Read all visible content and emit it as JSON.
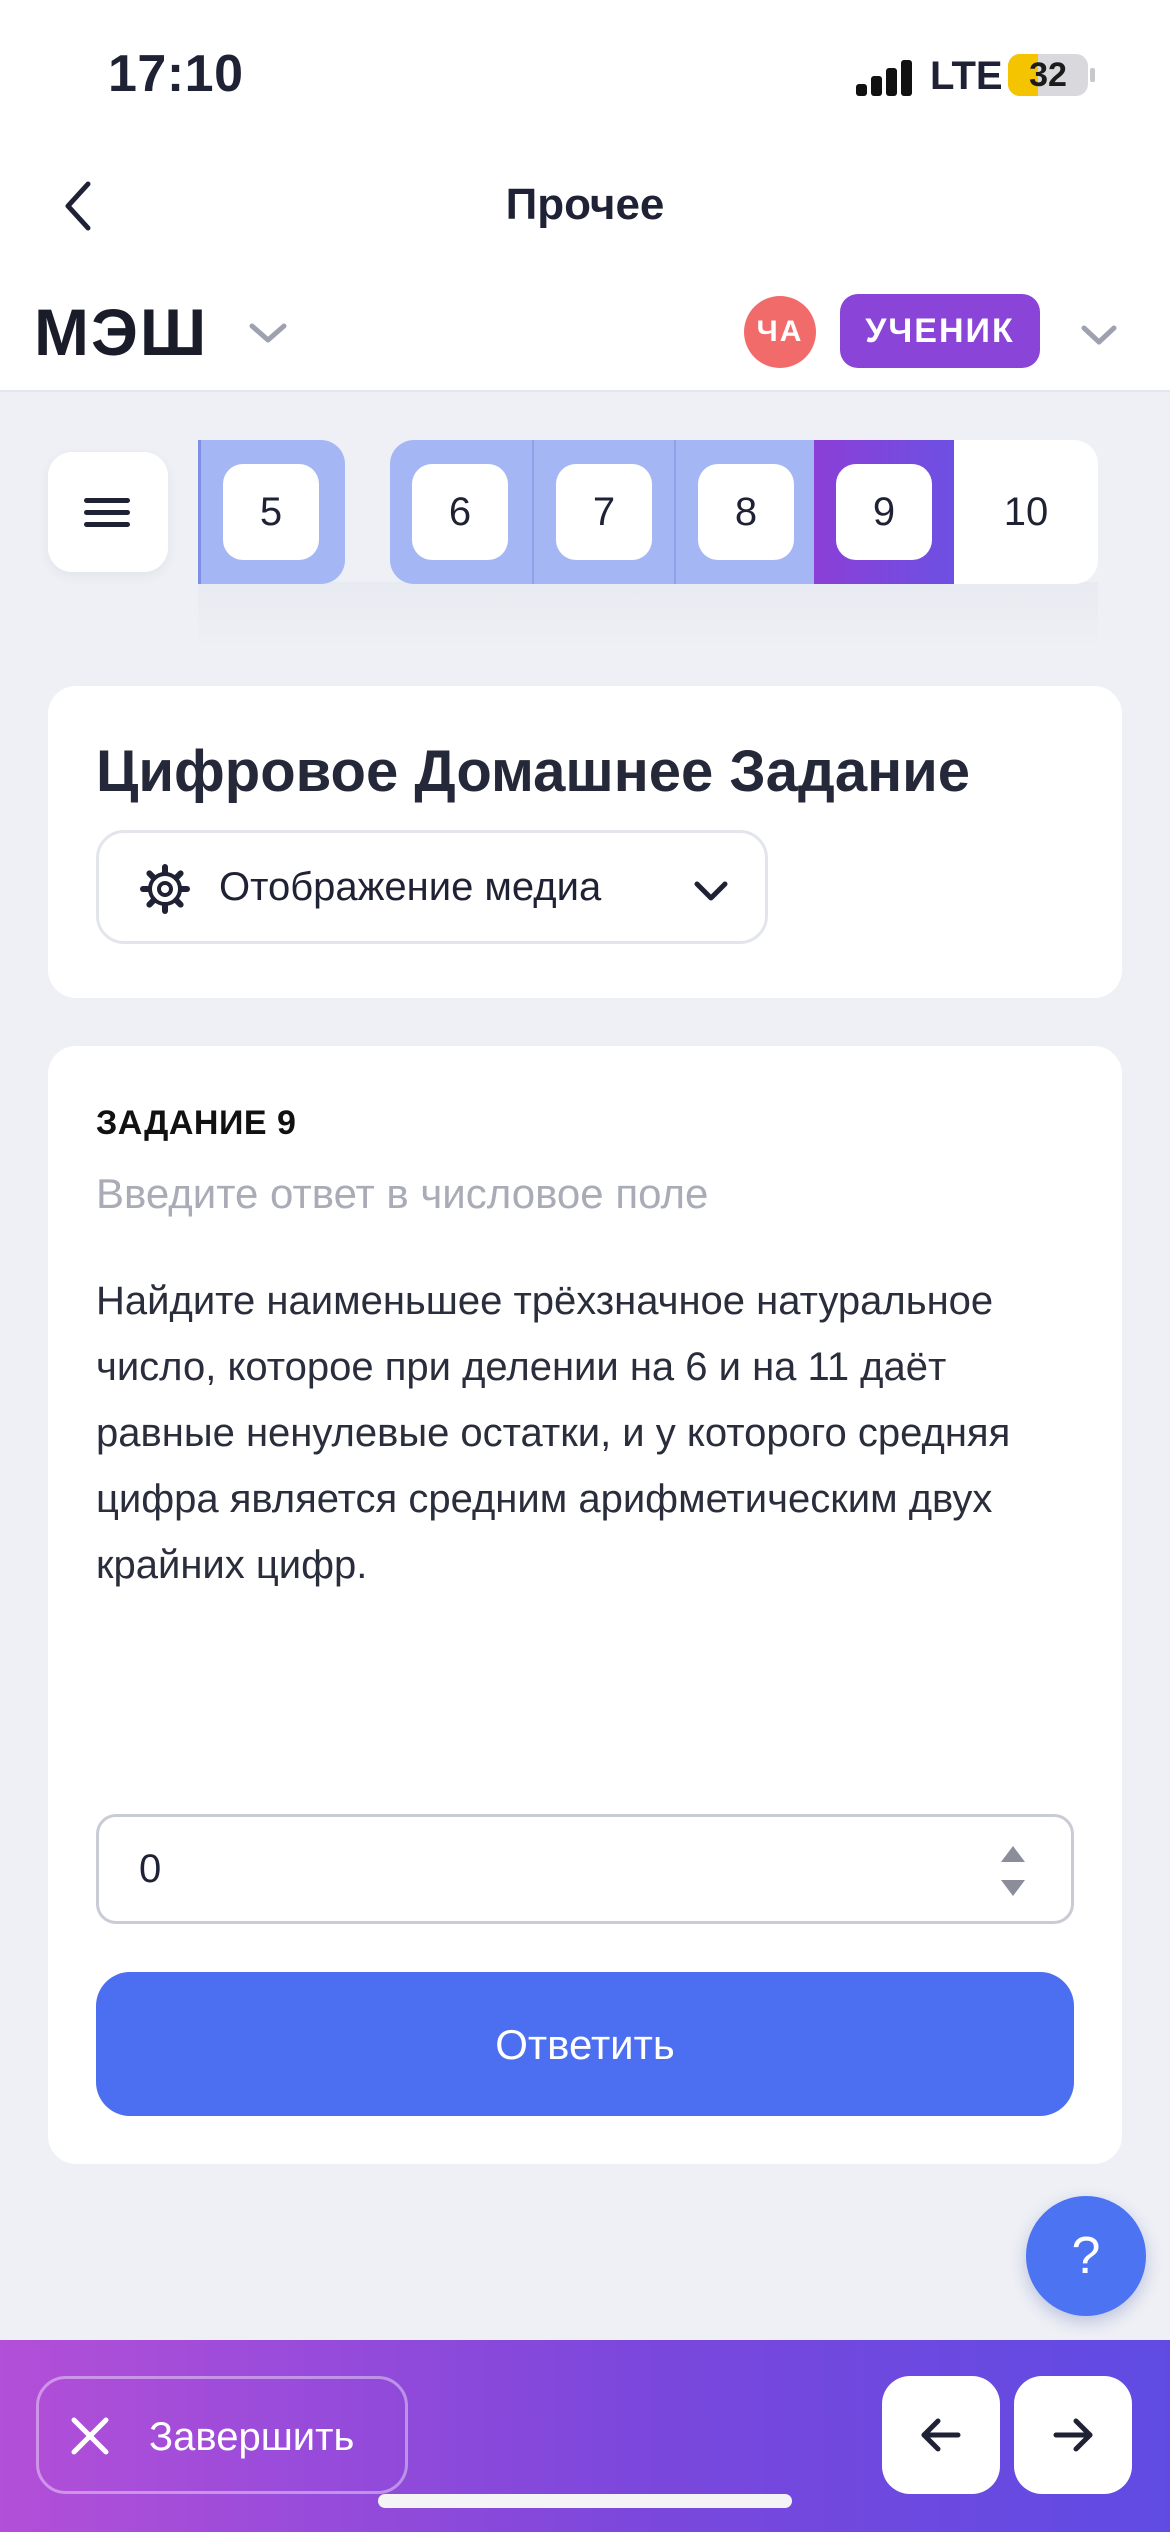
{
  "status_bar": {
    "time": "17:10",
    "network": "LTE",
    "battery": "32"
  },
  "header": {
    "title": "Прочее"
  },
  "brand": {
    "logo": "МЭШ",
    "avatar_initials": "ЧА",
    "role": "УЧЕНИК"
  },
  "task_nav": {
    "items": [
      {
        "label": "5",
        "state": "answered"
      },
      {
        "label": "6",
        "state": "answered"
      },
      {
        "label": "7",
        "state": "answered"
      },
      {
        "label": "8",
        "state": "answered"
      },
      {
        "label": "9",
        "state": "current"
      },
      {
        "label": "10",
        "state": "pending"
      }
    ]
  },
  "assignment": {
    "title": "Цифровое Домашнее Задание",
    "media_button": "Отображение медиа"
  },
  "task": {
    "number_label": "ЗАДАНИЕ 9",
    "hint": "Введите ответ в числовое поле",
    "text": "Найдите наименьшее трёхзначное натуральное число, которое при делении на 6 и на 11 даёт равные ненулевые остатки, и у которого средняя цифра является средним арифметическим двух крайних цифр.",
    "answer_value": "0",
    "submit_label": "Ответить"
  },
  "help": {
    "label": "?"
  },
  "footer": {
    "finish_label": "Завершить"
  },
  "colors": {
    "accent": "#4c6ef0",
    "current": "#8b3fd6",
    "answered": "#a4b6f4"
  }
}
